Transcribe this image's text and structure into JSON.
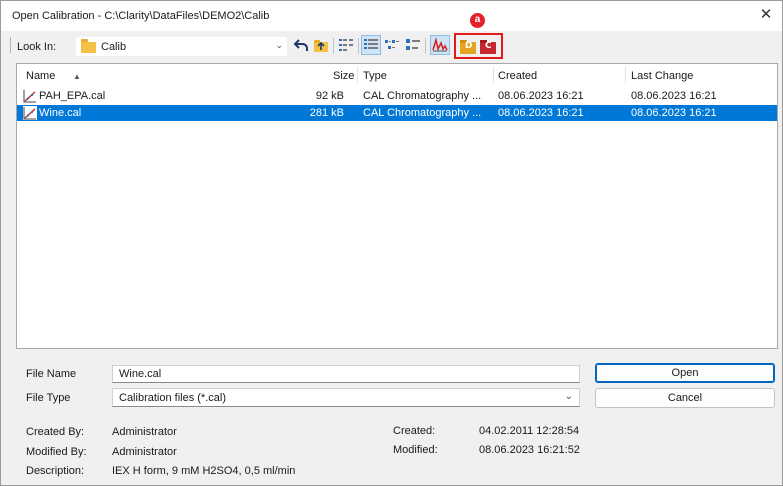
{
  "window": {
    "title": "Open Calibration - C:\\Clarity\\DataFiles\\DEMO2\\Calib",
    "close_glyph": "✕"
  },
  "toolbar": {
    "look_in_label": "Look In:",
    "look_in_value": "Calib",
    "annotation_badge": "a",
    "highlighted_buttons": [
      "D",
      "C"
    ],
    "icons": [
      "back-arrow-icon",
      "up-folder-icon",
      "list-view-icon",
      "details-view-icon",
      "small-icons-view-icon",
      "large-icons-view-icon",
      "preview-chromatogram-icon",
      "d-folder-icon",
      "c-folder-icon"
    ]
  },
  "file_list": {
    "columns": [
      "Name",
      "Size",
      "Type",
      "Created",
      "Last Change"
    ],
    "sort_indicator": "▲",
    "rows": [
      {
        "name": "PAH_EPA.cal",
        "size": "92 kB",
        "type": "CAL Chromatography ...",
        "created": "08.06.2023 16:21",
        "last_change": "08.06.2023 16:21",
        "selected": false
      },
      {
        "name": "Wine.cal",
        "size": "281 kB",
        "type": "CAL Chromatography ...",
        "created": "08.06.2023 16:21",
        "last_change": "08.06.2023 16:21",
        "selected": true
      }
    ]
  },
  "form": {
    "file_name_label": "File Name",
    "file_name_value": "Wine.cal",
    "file_type_label": "File Type",
    "file_type_value": "Calibration files (*.cal)"
  },
  "buttons": {
    "open": "Open",
    "cancel": "Cancel"
  },
  "info": {
    "created_by_label": "Created By:",
    "created_by_value": "Administrator",
    "modified_by_label": "Modified By:",
    "modified_by_value": "Administrator",
    "description_label": "Description:",
    "description_value": "IEX H form, 9 mM H2SO4, 0,5 ml/min",
    "created_label": "Created:",
    "created_value": "04.02.2011 12:28:54",
    "modified_label": "Modified:",
    "modified_value": "08.06.2023 16:21:52"
  },
  "colors": {
    "selection": "#0078d7",
    "highlight_box": "#e01a1a",
    "badge": "#e3232a",
    "folder": "#f3c244"
  }
}
